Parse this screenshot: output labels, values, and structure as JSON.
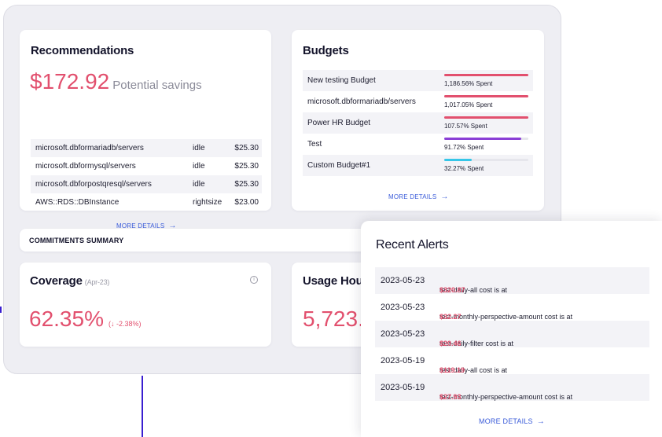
{
  "recommendations": {
    "title": "Recommendations",
    "savings_amount": "$172.92",
    "savings_label": "Potential savings",
    "rows": [
      {
        "name": "microsoft.dbformariadb/servers",
        "type": "idle",
        "cost": "$25.30"
      },
      {
        "name": "microsoft.dbformysql/servers",
        "type": "idle",
        "cost": "$25.30"
      },
      {
        "name": "microsoft.dbforpostqresql/servers",
        "type": "idle",
        "cost": "$25.30"
      },
      {
        "name": "AWS::RDS::DBInstance",
        "type": "rightsize",
        "cost": "$23.00"
      }
    ],
    "more_label": "MORE DETAILS"
  },
  "budgets": {
    "title": "Budgets",
    "rows": [
      {
        "name": "New testing Budget",
        "spent_label": "1,186.56% Spent",
        "progress": 1.0,
        "color": "#e2506e"
      },
      {
        "name": "microsoft.dbformariadb/servers",
        "spent_label": "1,017.05% Spent",
        "progress": 1.0,
        "color": "#e2506e"
      },
      {
        "name": "Power HR Budget",
        "spent_label": "107.57% Spent",
        "progress": 1.0,
        "color": "#e2506e"
      },
      {
        "name": "Test",
        "spent_label": "91.72% Spent",
        "progress": 0.9172,
        "color": "#8b3fd6"
      },
      {
        "name": "Custom Budget#1",
        "spent_label": "32.27% Spent",
        "progress": 0.3227,
        "color": "#35c6e8"
      }
    ],
    "more_label": "MORE DETAILS"
  },
  "commitments": {
    "title": "COMMITMENTS SUMMARY"
  },
  "coverage": {
    "title": "Coverage",
    "period": "(Apr-23)",
    "value": "62.35%",
    "delta": "(↓ -2.38%)",
    "info_icon": "info-icon"
  },
  "usage": {
    "title": "Usage Hou",
    "value": "5,723."
  },
  "alerts": {
    "title": "Recent Alerts",
    "rows": [
      {
        "date": "2023-05-23",
        "message": "test-daily-all cost is at",
        "amount": "$320.87"
      },
      {
        "date": "2023-05-23",
        "message": "test-monthly-perspective-amount cost is at",
        "amount": "$32.27"
      },
      {
        "date": "2023-05-23",
        "message": "test-daily-filter cost is at",
        "amount": "$20.46"
      },
      {
        "date": "2023-05-19",
        "message": "test-daily-all cost is at",
        "amount": "$119.19"
      },
      {
        "date": "2023-05-19",
        "message": "test-monthly-perspective-amount cost is at",
        "amount": "$27.93"
      }
    ],
    "more_label": "MORE DETAILS"
  },
  "colors": {
    "accent": "#e2506e",
    "link": "#3a5bd9",
    "budget_over": "#e2506e",
    "budget_near": "#8b3fd6",
    "budget_ok": "#35c6e8"
  }
}
